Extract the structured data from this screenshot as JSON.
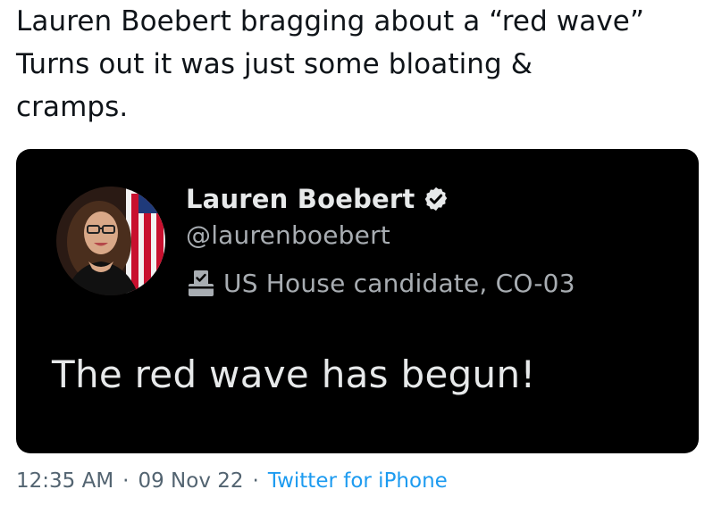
{
  "tweet": {
    "text": "Lauren Boebert bragging about a “red wave”\nTurns out it was just some bloating &\ncramps."
  },
  "quoted_tweet": {
    "display_name": "Lauren Boebert",
    "handle": "@laurenboebert",
    "label": "US House candidate, CO-03",
    "label_icon": "ballot-box-icon",
    "verified_icon": "verified-badge-icon",
    "text": "The red wave has begun!",
    "background_color": "#000000"
  },
  "meta": {
    "time": "12:35 AM",
    "separator": "·",
    "date": "09 Nov 22",
    "source": "Twitter for iPhone",
    "source_color": "#1d9bf0"
  }
}
